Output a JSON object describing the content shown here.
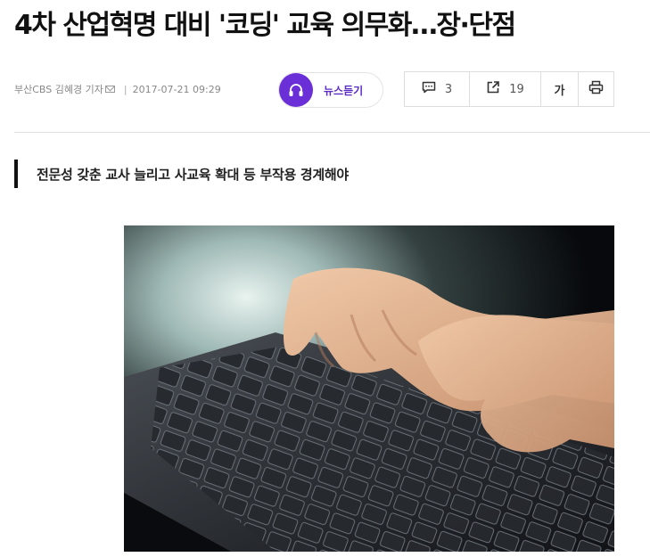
{
  "article": {
    "headline": "4차 산업혁명 대비 '코딩' 교육 의무화…장·단점",
    "byline": {
      "reporter": "부산CBS 김혜경 기자",
      "date": "2017-07-21 09:29"
    },
    "subheadline": "전문성 갖춘 교사 늘리고 사교육 확대 등 부작용 경계해야"
  },
  "toolbar": {
    "listen_label": "뉴스듣기",
    "comment_count": "3",
    "share_count": "19",
    "font_size_label": "가"
  },
  "photo": {
    "icon": "photo-keyboard-hands",
    "caption": ""
  },
  "colors": {
    "listen_accent": "#6a2fd6",
    "listen_text": "#5b2bc6"
  }
}
